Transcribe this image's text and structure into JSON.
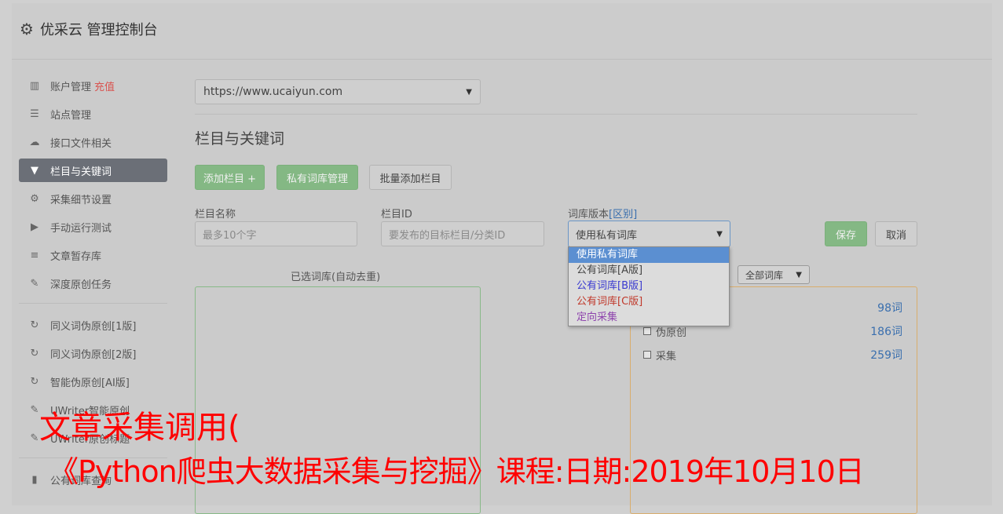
{
  "header": {
    "title": "优采云 管理控制台"
  },
  "sidebar": {
    "items": [
      {
        "label": "账户管理",
        "tag": "充值"
      },
      {
        "label": "站点管理"
      },
      {
        "label": "接口文件相关"
      },
      {
        "label": "栏目与关键词"
      },
      {
        "label": "采集细节设置"
      },
      {
        "label": "手动运行测试"
      },
      {
        "label": "文章暂存库"
      },
      {
        "label": "深度原创任务"
      }
    ],
    "items2": [
      {
        "label": "同义词伪原创[1版]"
      },
      {
        "label": "同义词伪原创[2版]"
      },
      {
        "label": "智能伪原创[AI版]"
      },
      {
        "label": "UWriter智能原创"
      },
      {
        "label": "UWriter原创标题"
      }
    ],
    "items3": [
      {
        "label": "公有词库查询"
      }
    ]
  },
  "main": {
    "site_select": "https://www.ucaiyun.com",
    "section_title": "栏目与关键词",
    "buttons": {
      "add_column": "添加栏目 +",
      "private_lib": "私有词库管理",
      "batch_add": "批量添加栏目",
      "save": "保存",
      "cancel": "取消"
    },
    "form": {
      "name_label": "栏目名称",
      "name_placeholder": "最多10个字",
      "id_label": "栏目ID",
      "id_placeholder": "要发布的目标栏目/分类ID",
      "version_label": "词库版本",
      "version_link": "[区别]",
      "version_value": "使用私有词库"
    },
    "dropdown": {
      "options": [
        "使用私有词库",
        "公有词库[A版]",
        "公有词库[B版]",
        "公有词库[C版]",
        "定向采集"
      ]
    },
    "selected_title": "已选词库(自动去重)",
    "filter_select": "全部词库",
    "libraries": [
      {
        "name": "",
        "count": "98词"
      },
      {
        "name": "伪原创",
        "count": "186词"
      },
      {
        "name": "采集",
        "count": "259词"
      }
    ]
  },
  "overlay": {
    "line1": "文章采集调用(",
    "line2": "《Python爬虫大数据采集与挖掘》课程:日期:2019年10月10日"
  },
  "colors": {
    "green_button": "#84b884",
    "active_nav": "#6b6f77",
    "dropdown_highlight": "#5b8fd1",
    "overlay_red": "#ff0000",
    "option_a": "#444444",
    "option_b": "#3a3ad0",
    "option_c": "#c0392b",
    "option_d": "#8e44ad"
  }
}
